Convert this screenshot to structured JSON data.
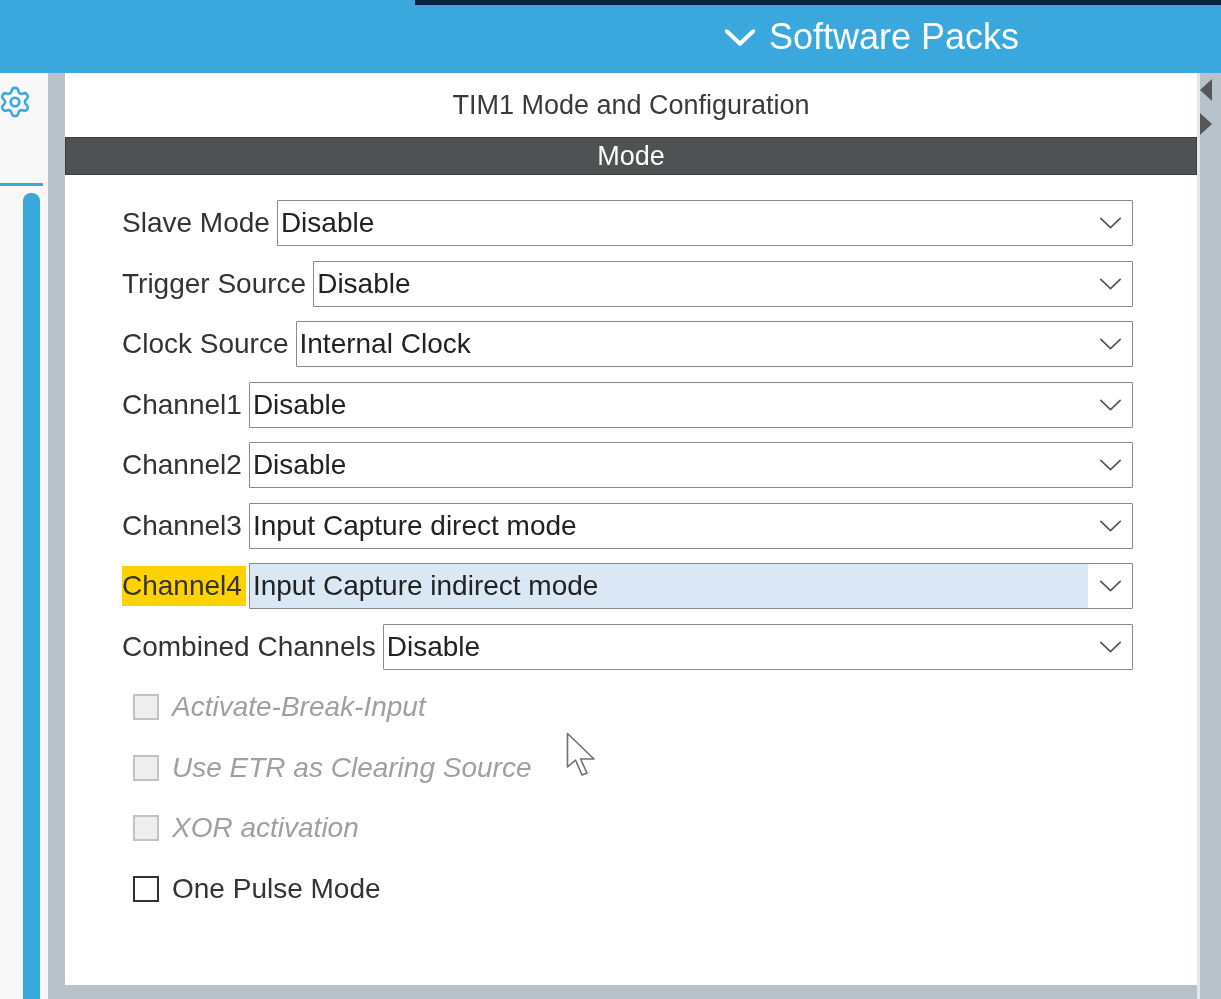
{
  "header": {
    "title": "Software Packs"
  },
  "panel": {
    "title": "TIM1 Mode and Configuration",
    "section": "Mode"
  },
  "fields": [
    {
      "label": "Slave Mode",
      "value": "Disable",
      "selected": false
    },
    {
      "label": "Trigger Source",
      "value": "Disable",
      "selected": false
    },
    {
      "label": "Clock Source",
      "value": "Internal Clock",
      "selected": false
    },
    {
      "label": "Channel1",
      "value": "Disable",
      "selected": false
    },
    {
      "label": "Channel2",
      "value": "Disable",
      "selected": false
    },
    {
      "label": "Channel3",
      "value": "Input Capture direct mode",
      "selected": false
    },
    {
      "label": "Channel4",
      "value": "Input Capture indirect mode",
      "selected": true
    },
    {
      "label": "Combined Channels",
      "value": "Disable",
      "selected": false
    }
  ],
  "options": [
    {
      "label": "Activate-Break-Input",
      "checked": false,
      "disabled": true
    },
    {
      "label": "Use ETR as Clearing Source",
      "checked": false,
      "disabled": true
    },
    {
      "label": "XOR activation",
      "checked": false,
      "disabled": true
    },
    {
      "label": "One Pulse Mode",
      "checked": false,
      "disabled": false
    }
  ]
}
